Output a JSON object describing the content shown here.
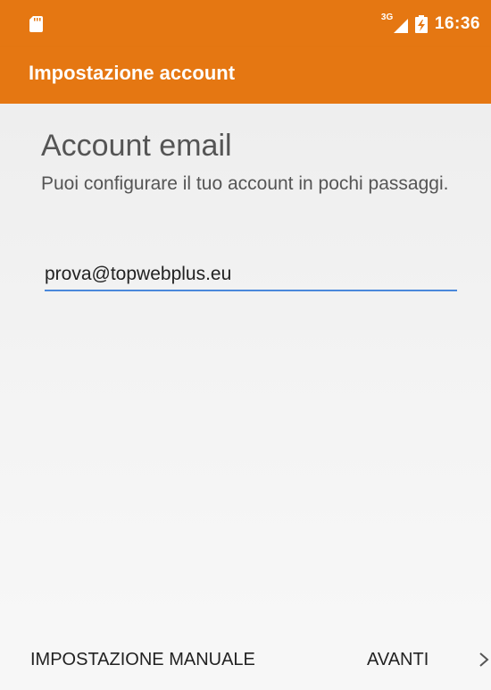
{
  "status_bar": {
    "network_label": "3G",
    "time": "16:36",
    "icons": [
      "sd-card-icon",
      "signal-icon",
      "battery-charging-icon"
    ]
  },
  "app_bar": {
    "title": "Impostazione account"
  },
  "main": {
    "heading": "Account email",
    "subtitle": "Puoi configurare il tuo account in pochi passaggi.",
    "email_value": "prova@topwebplus.eu"
  },
  "bottom_bar": {
    "manual_label": "IMPOSTAZIONE MANUALE",
    "next_label": "AVANTI",
    "more_icon": "chevron-right-icon"
  },
  "colors": {
    "accent": "#e57712",
    "input_underline": "#4a88db",
    "background": "#f5f5f5"
  }
}
